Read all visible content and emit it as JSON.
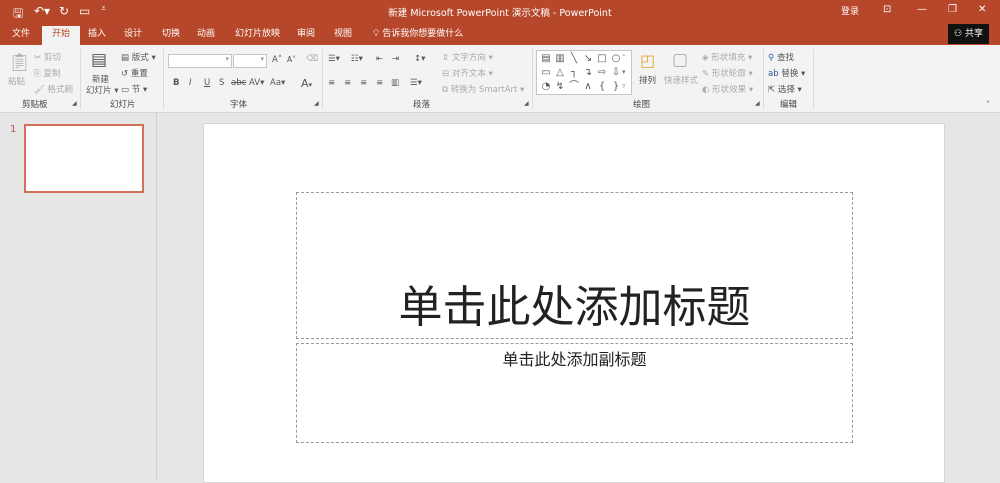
{
  "app": {
    "title": "新建 Microsoft PowerPoint 演示文稿 - PowerPoint",
    "accent": "#b7472a",
    "login": "登录",
    "share": "共享"
  },
  "quick_access": {
    "save": "save-icon",
    "undo": "undo-icon",
    "redo": "redo-icon",
    "present": "present-from-beginning-icon",
    "customize": "customize-icon"
  },
  "tabs": [
    {
      "label": "文件"
    },
    {
      "label": "开始",
      "active": true
    },
    {
      "label": "插入"
    },
    {
      "label": "设计"
    },
    {
      "label": "切换"
    },
    {
      "label": "动画"
    },
    {
      "label": "幻灯片放映"
    },
    {
      "label": "审阅"
    },
    {
      "label": "视图"
    }
  ],
  "tell_me": "告诉我你想要做什么",
  "ribbon": {
    "clipboard": {
      "name": "剪贴板",
      "paste": "粘贴",
      "cut": "剪切",
      "copy": "复制",
      "format_painter": "格式刷"
    },
    "slides": {
      "name": "幻灯片",
      "new_slide": "新建",
      "new_slide2": "幻灯片",
      "layout": "版式",
      "reset": "重置",
      "section": "节"
    },
    "font": {
      "name": "字体",
      "font_value": "",
      "size_value": "",
      "bold": "B",
      "italic": "I",
      "underline": "U",
      "shadow": "S",
      "strike": "abc",
      "spacing": "AV",
      "case": "Aa",
      "color": "A",
      "grow": "A",
      "shrink": "A"
    },
    "paragraph": {
      "name": "段落",
      "text_direction": "文字方向",
      "align_text": "对齐文本",
      "smartart": "转换为 SmartArt"
    },
    "drawing": {
      "name": "绘图",
      "arrange": "排列",
      "quick_styles": "快速样式",
      "fill": "形状填充",
      "outline": "形状轮廓",
      "effects": "形状效果",
      "shapes": [
        "▤",
        "▥",
        "╲",
        "↘",
        "□",
        "○",
        "▭",
        "△",
        "┐",
        "↴",
        "⇨",
        "⇩",
        "◔",
        "↯",
        "⌒",
        "∧",
        "{",
        "}"
      ]
    },
    "editing": {
      "name": "编辑",
      "find": "查找",
      "replace": "替换",
      "select": "选择"
    }
  },
  "thumbnails": [
    {
      "number": "1"
    }
  ],
  "slide": {
    "title_placeholder": "单击此处添加标题",
    "subtitle_placeholder": "单击此处添加副标题"
  }
}
